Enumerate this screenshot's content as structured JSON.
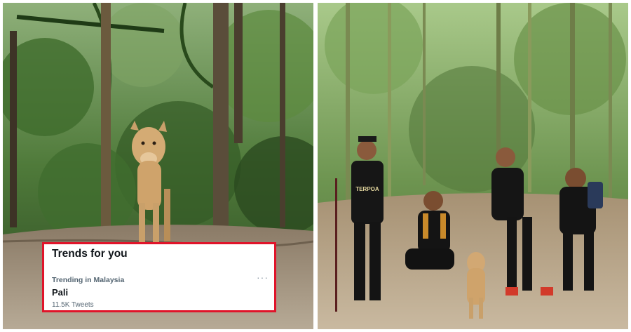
{
  "trends": {
    "title": "Trends for you",
    "items": [
      {
        "context": "Trending in Malaysia",
        "name": "Pali",
        "count": "11.5K Tweets",
        "more_icon": "more-horizontal-icon"
      }
    ]
  },
  "shirt_text": "TERPOA",
  "colors": {
    "card_border": "#e0142a",
    "trend_text": "#0f1419",
    "muted_text": "#536471"
  }
}
